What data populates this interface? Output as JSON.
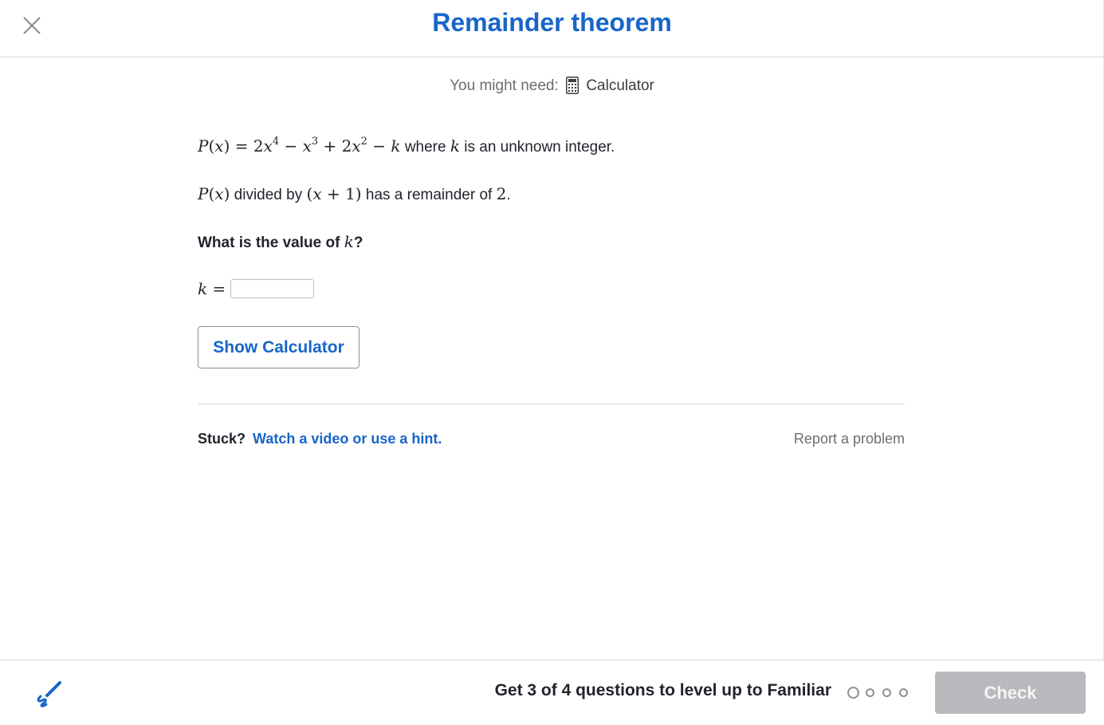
{
  "header": {
    "title": "Remainder theorem",
    "close_icon": "close-icon"
  },
  "might_need": {
    "prefix": "You might need:",
    "tool": "Calculator",
    "icon": "calculator-icon"
  },
  "question": {
    "line1_text": " where k is an unknown integer.",
    "line1_math": "P(x) = 2x⁴ − x³ + 2x² − k",
    "line2_text_a": " divided by ",
    "line2_text_b": " has a remainder of ",
    "line2_value": "2",
    "line3": "What is the value of k?",
    "answer_label": "k =",
    "answer_value": ""
  },
  "buttons": {
    "show_calculator": "Show Calculator",
    "check": "Check"
  },
  "help": {
    "stuck": "Stuck?",
    "hint_link": "Watch a video or use a hint.",
    "report": "Report a problem"
  },
  "footer": {
    "level_text": "Get 3 of 4 questions to level up to Familiar",
    "progress_completed": 0,
    "progress_total": 4,
    "scratchpad_icon": "pencil-scratchpad-icon"
  },
  "colors": {
    "accent": "#1865c9",
    "check_disabled": "#b9babd"
  }
}
